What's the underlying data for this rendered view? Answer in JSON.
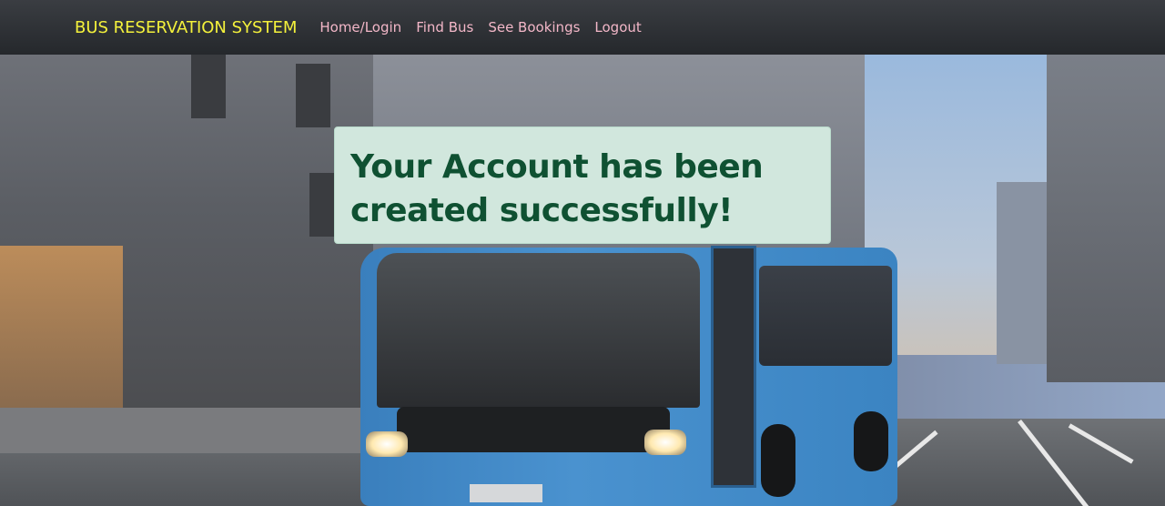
{
  "navbar": {
    "brand": "BUS RESERVATION SYSTEM",
    "links": [
      "Home/Login",
      "Find Bus",
      "See Bookings",
      "Logout"
    ]
  },
  "alert": {
    "message": "Your Account has been created successfully!"
  },
  "colors": {
    "brand": "#f4f13b",
    "nav_link": "#f3b7c8",
    "navbar_bg": "#2b2e33",
    "alert_bg": "#d1e7dd",
    "alert_text": "#0f5132"
  }
}
